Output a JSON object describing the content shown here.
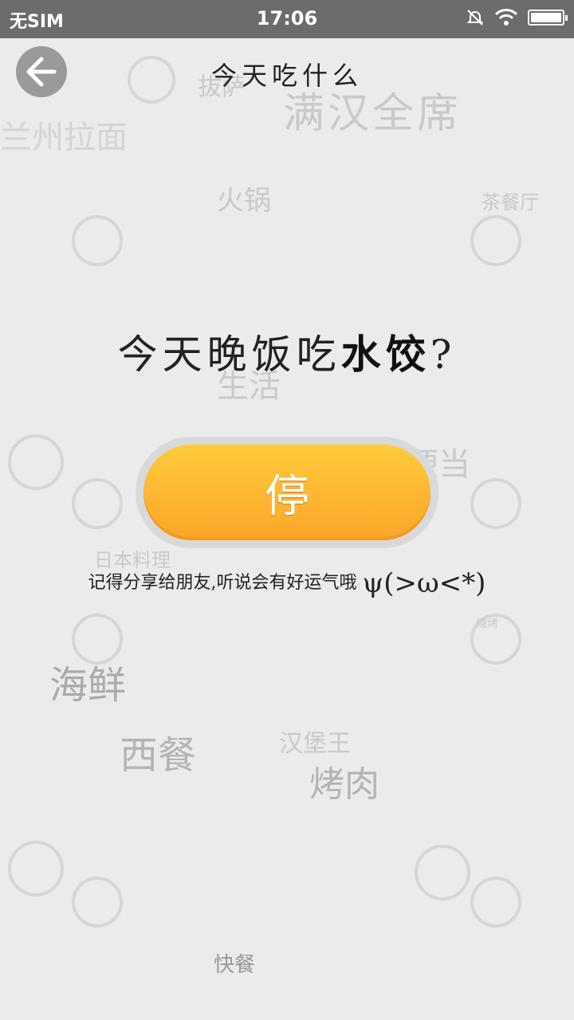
{
  "status_bar": {
    "carrier": "无SIM",
    "time": "17:06"
  },
  "header": {
    "title": "今天吃什么"
  },
  "prompt": {
    "prefix": "今天晚饭吃",
    "dish": "水饺",
    "suffix": "?"
  },
  "stop_button": {
    "label": "停"
  },
  "share_hint": {
    "text": "记得分享给朋友,听说会有好运气哦",
    "emoticon": "ψ(>ω<*)"
  },
  "background_words": [
    "拔萨",
    "满汉全席",
    "兰州拉面",
    "火锅",
    "茶餐厅",
    "生活",
    "家常便当",
    "日本料理",
    "烧烤",
    "海鲜",
    "西餐",
    "汉堡王",
    "烤肉",
    "快餐"
  ],
  "colors": {
    "button_top": "#ffca3b",
    "button_bottom": "#fba62a",
    "statusbar": "#6c6c6c"
  }
}
